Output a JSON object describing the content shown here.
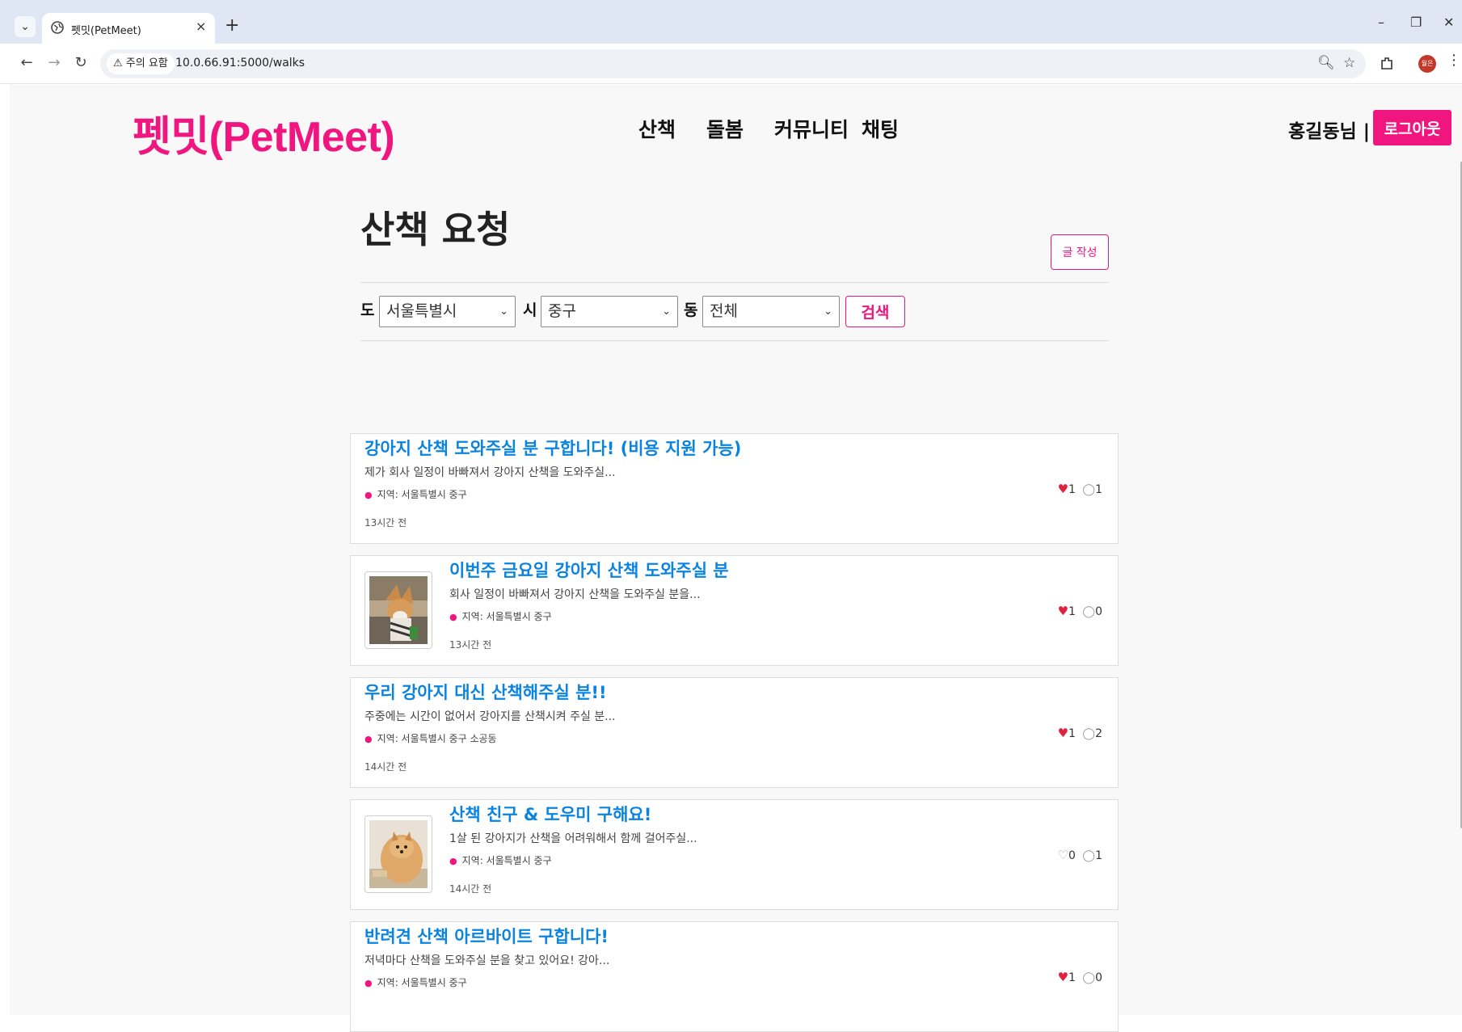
{
  "browser": {
    "tab_title": "펫밋(PetMeet)",
    "tab_close": "×",
    "new_tab": "+",
    "security_chip": "⚠ 주의 요함",
    "url": "10.0.66.91:5000/walks",
    "profile_initials": "월은"
  },
  "header": {
    "logo": "펫밋(PetMeet)",
    "nav": [
      "산책",
      "돌봄",
      "커뮤니티",
      "채팅"
    ],
    "greeting": "홍길동님 |",
    "logout_label": "로그아웃"
  },
  "main": {
    "title": "산책 요청",
    "write_label": "글 작성",
    "filter": {
      "do_label": "도",
      "do_value": "서울특별시",
      "si_label": "시",
      "si_value": "중구",
      "dong_label": "동",
      "dong_value": "전체",
      "search_label": "검색"
    },
    "posts": [
      {
        "title": "강아지 산책 도와주실 분 구합니다! (비용 지원 가능)",
        "excerpt": "제가 회사 일정이 바빠져서 강아지 산책을 도와주실...",
        "region": "지역: 서울특별시 중구",
        "time": "13시간 전",
        "likes": "1",
        "comments": "1",
        "liked": true,
        "thumb": ""
      },
      {
        "title": "이번주 금요일 강아지 산책 도와주실 분",
        "excerpt": "회사 일정이 바빠져서 강아지 산책을 도와주실 분을...",
        "region": "지역: 서울특별시 중구",
        "time": "13시간 전",
        "likes": "1",
        "comments": "0",
        "liked": true,
        "thumb": "corgi-photo"
      },
      {
        "title": "우리 강아지 대신 산책해주실 분!!",
        "excerpt": "주중에는 시간이 없어서 강아지를 산책시켜 주실 분...",
        "region": "지역: 서울특별시 중구 소공동",
        "time": "14시간 전",
        "likes": "1",
        "comments": "2",
        "liked": true,
        "thumb": ""
      },
      {
        "title": "산책 친구 & 도우미 구해요!",
        "excerpt": "1살 된 강아지가 산책을 어려워해서 함께 걸어주실...",
        "region": "지역: 서울특별시 중구",
        "time": "14시간 전",
        "likes": "0",
        "comments": "1",
        "liked": false,
        "thumb": "pomeranian-photo"
      },
      {
        "title": "반려견 산책 아르바이트 구합니다!",
        "excerpt": "저녁마다 산책을 도와주실 분을 찾고 있어요! 강아...",
        "region": "지역: 서울특별시 중구",
        "time": "",
        "likes": "1",
        "comments": "0",
        "liked": true,
        "thumb": ""
      }
    ]
  },
  "colors": {
    "brand": "#f0157f",
    "link": "#0a84e0",
    "heart": "#e0233c"
  }
}
